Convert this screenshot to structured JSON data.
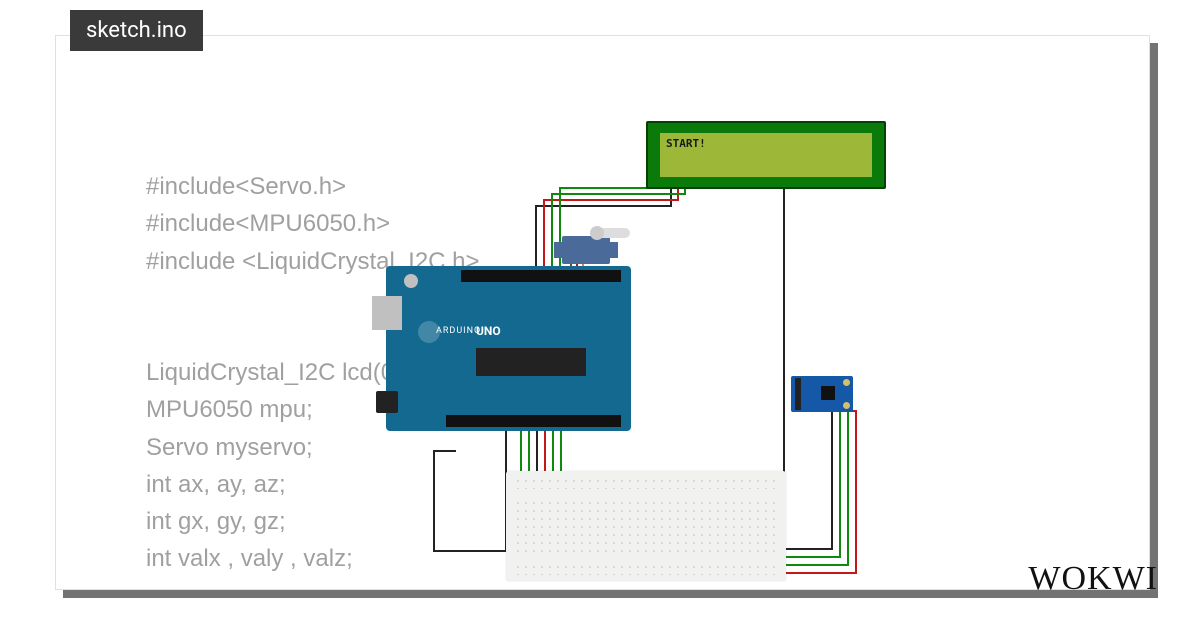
{
  "tab": {
    "filename": "sketch.ino"
  },
  "code": {
    "line1": "#include<Servo.h>",
    "line2": "#include<MPU6050.h>",
    "line3": "#include <LiquidCrystal_I2C.h>",
    "line4": "",
    "line5": "",
    "line6": "LiquidCrystal_I2C lcd(0x",
    "line7": "MPU6050 mpu;",
    "line8": "Servo myservo;",
    "line9": "int ax, ay, az;",
    "line10": "int gx, gy, gz;",
    "line11": "int valx , valy , valz;"
  },
  "components": {
    "lcd": {
      "text": "START!"
    },
    "arduino": {
      "label_small": "ARDUINO",
      "label_big": "UNO"
    }
  },
  "brand": {
    "logo": "WOKWI"
  },
  "wire_colors": {
    "gnd": "#222222",
    "vcc": "#c41818",
    "signal": "#0f8a0f",
    "signal2": "#0f8a0f"
  }
}
